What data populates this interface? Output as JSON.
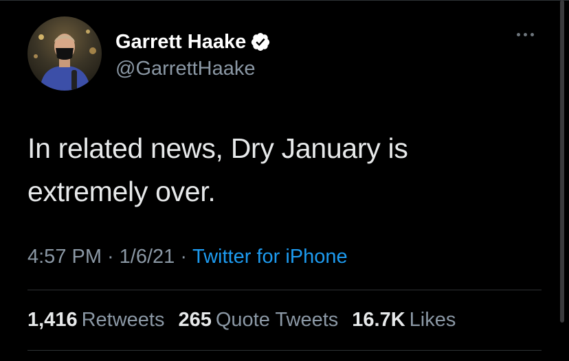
{
  "author": {
    "display_name": "Garrett Haake",
    "handle": "@GarrettHaake",
    "verified": true,
    "avatar": "avatar-photo-man-in-mask-with-microphone"
  },
  "tweet": {
    "text_line1": "In related news, Dry January is",
    "text_line2": "extremely over.",
    "time": "4:57 PM",
    "date": "1/6/21",
    "separator": "·",
    "source": "Twitter for iPhone"
  },
  "stats": {
    "retweets_count": "1,416",
    "retweets_label": "Retweets",
    "quote_count": "265",
    "quote_label": "Quote Tweets",
    "likes_count": "16.7K",
    "likes_label": "Likes"
  },
  "icons": {
    "verified": "verified-badge-icon",
    "more": "more-options-icon"
  },
  "colors": {
    "background": "#000000",
    "text": "#e7e9ea",
    "secondary": "#8b98a5",
    "link": "#1d9bf0",
    "divider": "#2f3336"
  }
}
